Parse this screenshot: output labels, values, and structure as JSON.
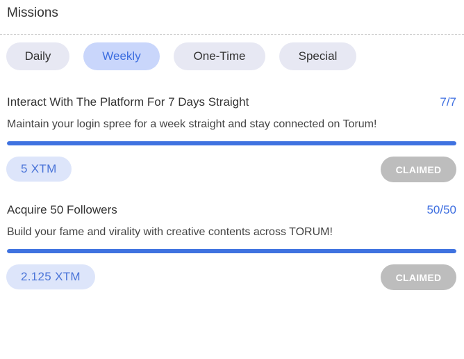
{
  "header": {
    "title": "Missions"
  },
  "tabs": [
    {
      "label": "Daily",
      "active": false
    },
    {
      "label": "Weekly",
      "active": true
    },
    {
      "label": "One-Time",
      "active": false
    },
    {
      "label": "Special",
      "active": false
    }
  ],
  "missions": [
    {
      "title": "Interact With The Platform For 7 Days Straight",
      "progress_text": "7/7",
      "progress_fraction": 1.0,
      "description": "Maintain your login spree for a week straight and stay connected on Torum!",
      "reward": "5 XTM",
      "status": "CLAIMED"
    },
    {
      "title": "Acquire 50 Followers",
      "progress_text": "50/50",
      "progress_fraction": 1.0,
      "description": "Build your fame and virality with creative contents across TORUM!",
      "reward": "2.125 XTM",
      "status": "CLAIMED"
    }
  ],
  "colors": {
    "accent": "#3d6ee0",
    "tab_active_bg": "#c9d6fb",
    "tab_bg": "#e7e8f3",
    "claimed_bg": "#bdbdbd"
  }
}
